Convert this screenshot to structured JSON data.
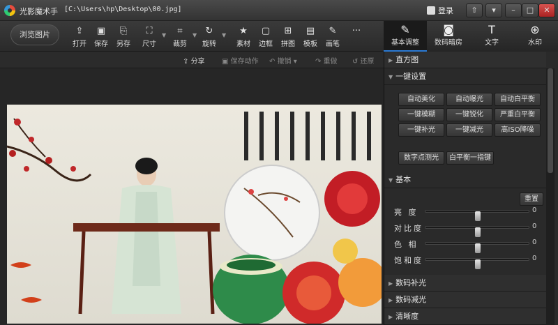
{
  "window": {
    "app_name": "光影魔术手",
    "file_path": "[C:\\Users\\hp\\Desktop\\00.jpg]",
    "login_label": "登录",
    "controls": [
      "⇧",
      "▾",
      "–",
      "□",
      "✕"
    ]
  },
  "toolbar": {
    "browse_label": "浏览图片",
    "tools": [
      {
        "label": "打开",
        "icon": "open-icon"
      },
      {
        "label": "保存",
        "icon": "save-icon"
      },
      {
        "label": "另存",
        "icon": "save-as-icon"
      },
      {
        "label": "尺寸",
        "icon": "resize-icon"
      },
      {
        "label": "裁剪",
        "icon": "crop-icon"
      },
      {
        "label": "旋转",
        "icon": "rotate-icon"
      },
      {
        "label": "素材",
        "icon": "material-icon"
      },
      {
        "label": "边框",
        "icon": "border-icon"
      },
      {
        "label": "拼图",
        "icon": "collage-icon"
      },
      {
        "label": "模板",
        "icon": "template-icon"
      },
      {
        "label": "画笔",
        "icon": "brush-icon"
      }
    ]
  },
  "right_tabs": [
    {
      "label": "基本调整",
      "icon": "edit-icon",
      "active": true
    },
    {
      "label": "数码暗房",
      "icon": "camera-icon",
      "active": false
    },
    {
      "label": "文字",
      "icon": "text-icon",
      "active": false
    },
    {
      "label": "水印",
      "icon": "watermark-icon",
      "active": false
    }
  ],
  "subbar": {
    "share": "分享",
    "save_action": "保存动作",
    "undo": "撤销",
    "redo": "重做",
    "restore": "还原"
  },
  "panel": {
    "histogram": "直方图",
    "one_click": "一键设置",
    "buttons": [
      [
        "自动美化",
        "自动曝光",
        "自动白平衡"
      ],
      [
        "一键模糊",
        "一键锐化",
        "严重白平衡"
      ],
      [
        "一键补光",
        "一键减光",
        "高ISO降噪"
      ]
    ],
    "extra_buttons": [
      "数字点测光",
      "白平衡一指键"
    ],
    "basic": "基本",
    "reset": "重置",
    "sliders": [
      {
        "label": "亮 度",
        "value": "0",
        "level": 0.5
      },
      {
        "label": "对比度",
        "value": "0",
        "level": 0.5
      },
      {
        "label": "色 相",
        "value": "0",
        "level": 0.5
      },
      {
        "label": "饱和度",
        "value": "0",
        "level": 0.5
      }
    ],
    "collapsed": [
      "数码补光",
      "数码减光",
      "清晰度"
    ]
  }
}
